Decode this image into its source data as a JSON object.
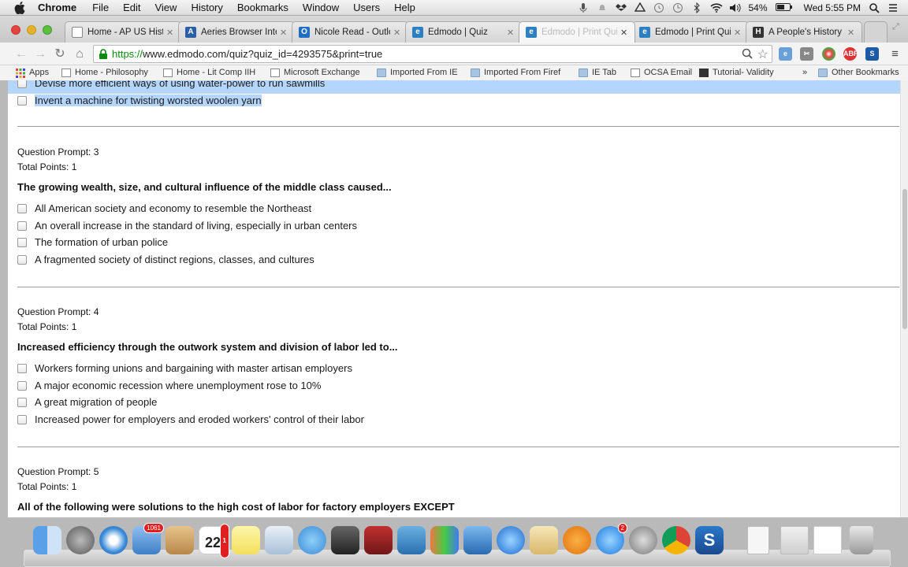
{
  "menubar": {
    "app": "Chrome",
    "menus": [
      "File",
      "Edit",
      "View",
      "History",
      "Bookmarks",
      "Window",
      "Users",
      "Help"
    ],
    "battery": "54%",
    "clock": "Wed 5:55 PM"
  },
  "tabs": [
    {
      "label": "Home - AP US Histo",
      "icon": "page-icon"
    },
    {
      "label": "Aeries Browser Inter",
      "icon": "aeries-icon"
    },
    {
      "label": "Nicole Read - Outlo",
      "icon": "outlook-icon"
    },
    {
      "label": "Edmodo | Quiz",
      "icon": "edmodo-icon"
    },
    {
      "label": "Edmodo | Print Quiz",
      "icon": "edmodo-icon"
    },
    {
      "label": "Edmodo | Print Quiz",
      "icon": "edmodo-icon"
    },
    {
      "label": "A People's History of",
      "icon": "hw-icon"
    }
  ],
  "address": {
    "scheme": "https://",
    "rest": "www.edmodo.com/quiz?quiz_id=4293575&print=true"
  },
  "bookmarks": [
    {
      "label": "Apps",
      "icon": "apps-grid-icon"
    },
    {
      "label": "Home - Philosophy",
      "icon": "page-icon"
    },
    {
      "label": "Home - Lit Comp IIH",
      "icon": "page-icon"
    },
    {
      "label": "Microsoft Exchange",
      "icon": "page-icon"
    },
    {
      "label": "Imported From IE",
      "icon": "folder-icon"
    },
    {
      "label": "Imported From Firef",
      "icon": "folder-icon"
    },
    {
      "label": "IE Tab",
      "icon": "folder-icon"
    },
    {
      "label": "OCSA Email",
      "icon": "page-icon"
    },
    {
      "label": "Tutorial- Validity",
      "icon": "tutorial-icon"
    },
    {
      "label": "»",
      "icon": ""
    },
    {
      "label": "Other Bookmarks",
      "icon": "folder-icon"
    }
  ],
  "quiz": {
    "prev_options": [
      "Devise more efficient ways of using water-power to run sawmills",
      "Invent a machine for twisting worsted woolen yarn"
    ],
    "questions": [
      {
        "prompt": "Question Prompt: 3",
        "points": "Total Points: 1",
        "text": "The growing wealth, size, and cultural influence of the middle class caused...",
        "options": [
          "All American society and economy to resemble the Northeast",
          "An overall increase in the standard of living, especially in urban centers",
          "The formation of urban police",
          "A fragmented society of distinct regions, classes, and cultures"
        ]
      },
      {
        "prompt": "Question Prompt: 4",
        "points": "Total Points: 1",
        "text": "Increased efficiency through the outwork system and division of labor led to...",
        "options": [
          "Workers forming unions and bargaining with master artisan employers",
          "A major economic recession where unemployment rose to 10%",
          "A great migration of people",
          "Increased power for employers and eroded workers' control of their labor"
        ]
      },
      {
        "prompt": "Question Prompt: 5",
        "points": "Total Points: 1",
        "text": "All of the following were solutions to the high cost of labor for factory employers EXCEPT",
        "options": []
      }
    ]
  },
  "dock": {
    "badges": {
      "mail": "1061",
      "calendar": "1",
      "appstore": "2"
    },
    "calendar_day": "22"
  }
}
